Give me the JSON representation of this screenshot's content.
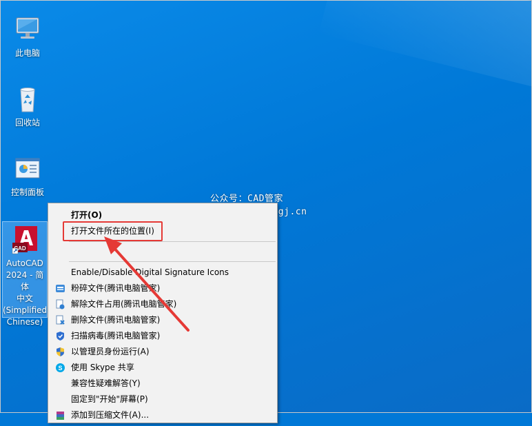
{
  "desktop": {
    "icons": [
      {
        "label": "此电脑",
        "icon": "computer-icon"
      },
      {
        "label": "回收站",
        "icon": "recycle-bin-icon"
      },
      {
        "label": "控制面板",
        "icon": "control-panel-icon"
      },
      {
        "label": "AutoCAD\n2024 - 简体\n中文\n(Simplified\nChinese)",
        "icon": "autocad-icon",
        "badge": "CAD"
      }
    ]
  },
  "watermark": {
    "line1": "公众号：CAD管家",
    "line2": "官网：www.cadgj.cn"
  },
  "context_menu": {
    "items": [
      {
        "label": "打开(O)",
        "bold": true,
        "icon": ""
      },
      {
        "label": "打开文件所在的位置(I)",
        "bold": false,
        "icon": ""
      },
      {
        "label": "Enable/Disable Digital Signature Icons",
        "bold": false,
        "icon": ""
      },
      {
        "label": "粉碎文件(腾讯电脑管家)",
        "bold": false,
        "icon": "shred-icon"
      },
      {
        "label": "解除文件占用(腾讯电脑管家)",
        "bold": false,
        "icon": "unlock-file-icon"
      },
      {
        "label": "删除文件(腾讯电脑管家)",
        "bold": false,
        "icon": "delete-file-icon"
      },
      {
        "label": "扫描病毒(腾讯电脑管家)",
        "bold": false,
        "icon": "virus-scan-icon"
      },
      {
        "label": "以管理员身份运行(A)",
        "bold": false,
        "icon": "uac-shield-icon"
      },
      {
        "label": "使用 Skype 共享",
        "bold": false,
        "icon": "skype-icon"
      },
      {
        "label": "兼容性疑难解答(Y)",
        "bold": false,
        "icon": ""
      },
      {
        "label": "固定到\"开始\"屏幕(P)",
        "bold": false,
        "icon": ""
      },
      {
        "label": "添加到压缩文件(A)...",
        "bold": false,
        "icon": "archive-icon"
      }
    ]
  },
  "colors": {
    "desktop": "#0078d7",
    "highlight": "#e53935",
    "autocad_red": "#c8102e"
  }
}
